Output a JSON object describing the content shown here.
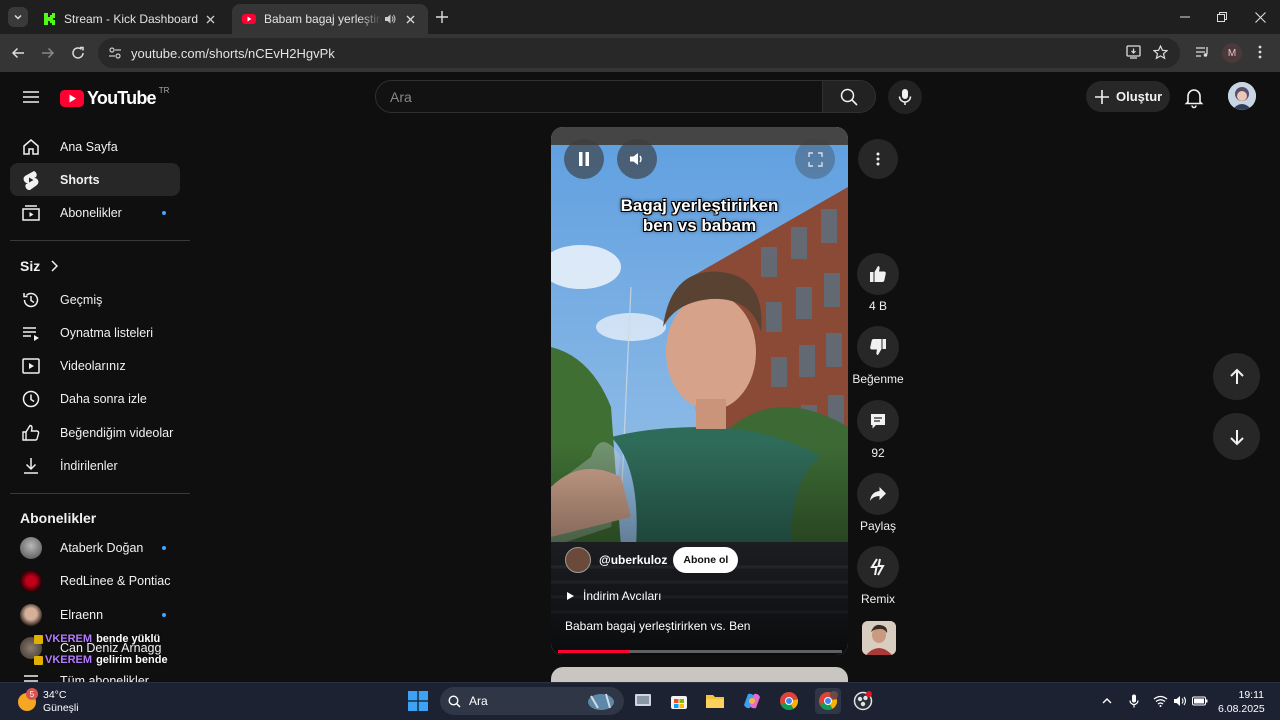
{
  "browser": {
    "tabs": [
      {
        "title": "Stream - Kick Dashboard"
      },
      {
        "title": "Babam bagaj yerleştirirken vs. Ben - YouTube"
      }
    ],
    "url": "youtube.com/shorts/nCEvH2HgvPk",
    "profile_initial": "M"
  },
  "header": {
    "logo_text": "YouTube",
    "country_code": "TR",
    "search_placeholder": "Ara",
    "create_label": "Oluştur"
  },
  "sidebar": {
    "main": [
      {
        "label": "Ana Sayfa",
        "icon": "home-icon"
      },
      {
        "label": "Shorts",
        "icon": "shorts-icon",
        "active": true
      },
      {
        "label": "Abonelikler",
        "icon": "subscriptions-icon",
        "dot": true
      }
    ],
    "you_header": "Siz",
    "you": [
      {
        "label": "Geçmiş",
        "icon": "history-icon"
      },
      {
        "label": "Oynatma listeleri",
        "icon": "playlists-icon"
      },
      {
        "label": "Videolarınız",
        "icon": "your-videos-icon"
      },
      {
        "label": "Daha sonra izle",
        "icon": "watch-later-icon"
      },
      {
        "label": "Beğendiğim videolar",
        "icon": "liked-videos-icon"
      },
      {
        "label": "İndirilenler",
        "icon": "downloads-icon"
      }
    ],
    "subs_header": "Abonelikler",
    "subscriptions": [
      {
        "name": "Ataberk Doğan",
        "dot": true
      },
      {
        "name": "RedLinee & Pontiac",
        "dot": false
      },
      {
        "name": "Elraenn",
        "dot": true
      },
      {
        "name": "Can Deniz Arnagg",
        "dot": false
      },
      {
        "name": "Tüm abonelikler",
        "dot": false
      }
    ]
  },
  "chat_overlay": [
    {
      "user": "VKEREM",
      "message": "bende yüklü"
    },
    {
      "user": "VKEREM",
      "message": "gelirim bende"
    }
  ],
  "short": {
    "caption_line1": "Bagaj yerleştirirken",
    "caption_line2": "ben vs babam",
    "channel_handle": "@uberkuloz",
    "subscribe_label": "Abone ol",
    "sound": "İndirim Avcıları",
    "title": "Babam bagaj yerleştirirken vs. Ben",
    "progress_fraction": 0.25
  },
  "actions": {
    "likes": "4 B",
    "dislike_label": "Beğenme",
    "comments": "92",
    "share_label": "Paylaş",
    "remix_label": "Remix"
  },
  "taskbar": {
    "temperature": "34°C",
    "weather": "Güneşli",
    "weather_badge": "5",
    "search_label": "Ara",
    "time": "19:11",
    "date": "6.08.2025"
  }
}
